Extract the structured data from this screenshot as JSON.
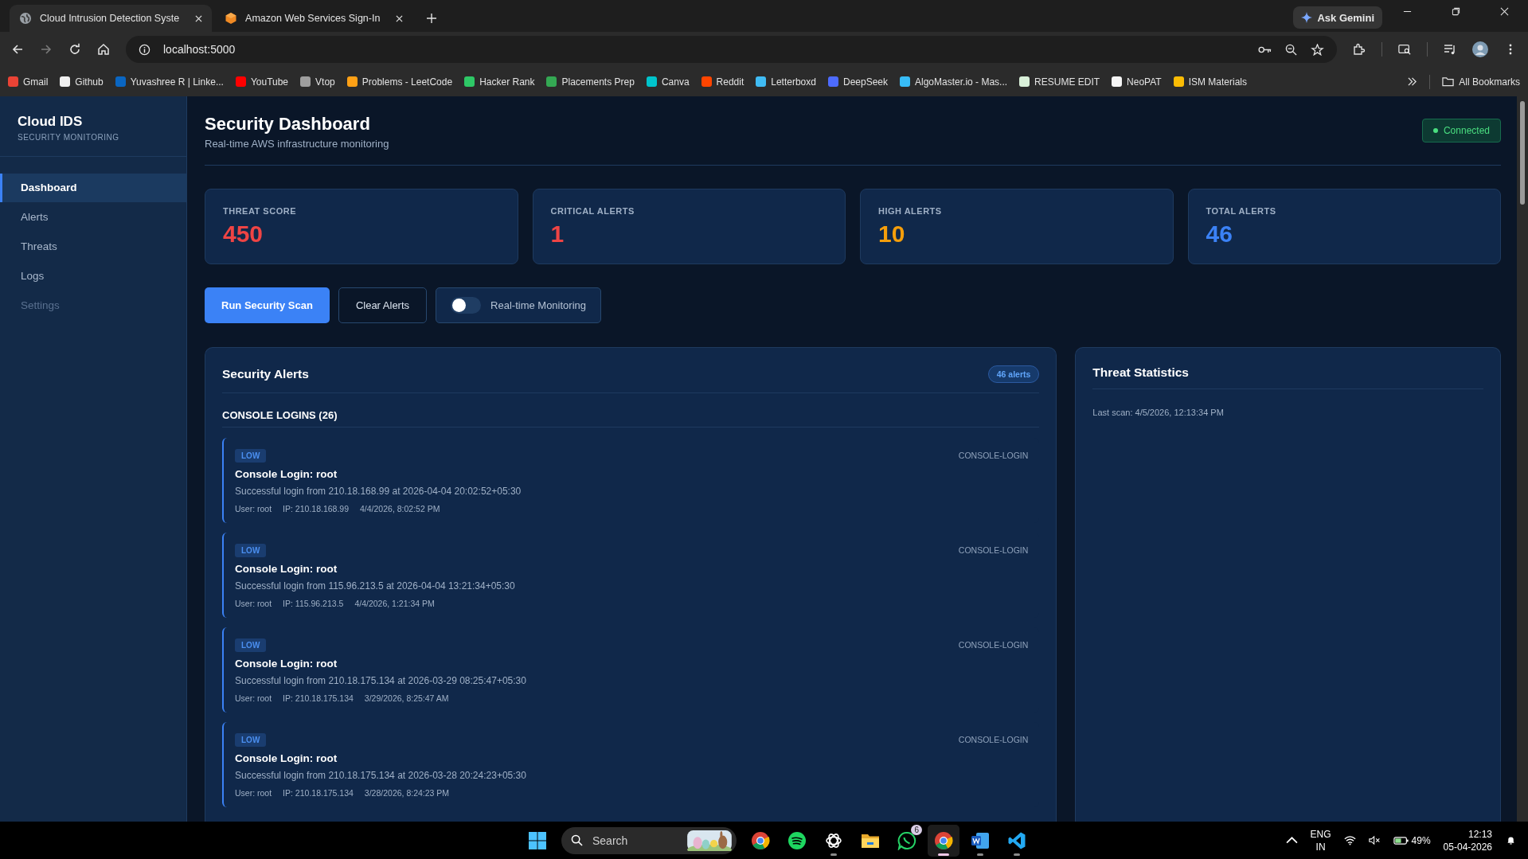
{
  "browser": {
    "tabs": [
      {
        "title": "Cloud Intrusion Detection Syste",
        "selected": true,
        "kind": "globe"
      },
      {
        "title": "Amazon Web Services Sign-In",
        "selected": false,
        "kind": "cube"
      }
    ],
    "gemini_button": "Ask Gemini",
    "address": "localhost:5000",
    "bookmarks": [
      {
        "label": "Gmail",
        "color": "#ea4335"
      },
      {
        "label": "Github",
        "color": "#f0f0f0"
      },
      {
        "label": "Yuvashree R | Linke...",
        "color": "#0a66c2"
      },
      {
        "label": "YouTube",
        "color": "#ff0000"
      },
      {
        "label": "Vtop",
        "color": "#9e9e9e"
      },
      {
        "label": "Problems - LeetCode",
        "color": "#ffa116"
      },
      {
        "label": "Hacker Rank",
        "color": "#2ec866"
      },
      {
        "label": "Placements Prep",
        "color": "#34a853"
      },
      {
        "label": "Canva",
        "color": "#00c4cc"
      },
      {
        "label": "Reddit",
        "color": "#ff4500"
      },
      {
        "label": "Letterboxd",
        "color": "#40bcf4"
      },
      {
        "label": "DeepSeek",
        "color": "#4d6bfe"
      },
      {
        "label": "AlgoMaster.io - Mas...",
        "color": "#38bdf8"
      },
      {
        "label": "RESUME EDIT",
        "color": "#d9f0d9"
      },
      {
        "label": "NeoPAT",
        "color": "#f5f5f5"
      },
      {
        "label": "ISM Materials",
        "color": "#fbbc04"
      }
    ],
    "all_bookmarks": "All Bookmarks"
  },
  "sidebar": {
    "brand": "Cloud IDS",
    "tagline": "SECURITY MONITORING",
    "items": [
      {
        "label": "Dashboard",
        "selected": true,
        "disabled": false
      },
      {
        "label": "Alerts",
        "selected": false,
        "disabled": false
      },
      {
        "label": "Threats",
        "selected": false,
        "disabled": false
      },
      {
        "label": "Logs",
        "selected": false,
        "disabled": false
      },
      {
        "label": "Settings",
        "selected": false,
        "disabled": true
      }
    ]
  },
  "header": {
    "title": "Security Dashboard",
    "subtitle": "Real-time AWS infrastructure monitoring",
    "status": "Connected"
  },
  "stats": [
    {
      "label": "THREAT SCORE",
      "value": "450",
      "color": "#ef4444"
    },
    {
      "label": "CRITICAL ALERTS",
      "value": "1",
      "color": "#ef4444"
    },
    {
      "label": "HIGH ALERTS",
      "value": "10",
      "color": "#f59e0b"
    },
    {
      "label": "TOTAL ALERTS",
      "value": "46",
      "color": "#3b82f6"
    }
  ],
  "actions": {
    "scan_button": "Run Security Scan",
    "clear_button": "Clear Alerts",
    "monitoring": {
      "label": "Real-time Monitoring",
      "on": false
    }
  },
  "alerts_panel": {
    "title": "Security Alerts",
    "count": "46 alerts",
    "groups": [
      {
        "title": "CONSOLE LOGINS (26)",
        "alerts": [
          {
            "severity": "LOW",
            "title": "Console Login: root",
            "description": "Successful login from 210.18.168.99 at 2026-04-04 20:02:52+05:30",
            "user": "User: root",
            "ip": "IP: 210.18.168.99",
            "time": "4/4/2026, 8:02:52 PM",
            "type": "CONSOLE-LOGIN"
          },
          {
            "severity": "LOW",
            "title": "Console Login: root",
            "description": "Successful login from 115.96.213.5 at 2026-04-04 13:21:34+05:30",
            "user": "User: root",
            "ip": "IP: 115.96.213.5",
            "time": "4/4/2026, 1:21:34 PM",
            "type": "CONSOLE-LOGIN"
          },
          {
            "severity": "LOW",
            "title": "Console Login: root",
            "description": "Successful login from 210.18.175.134 at 2026-03-29 08:25:47+05:30",
            "user": "User: root",
            "ip": "IP: 210.18.175.134",
            "time": "3/29/2026, 8:25:47 AM",
            "type": "CONSOLE-LOGIN"
          },
          {
            "severity": "LOW",
            "title": "Console Login: root",
            "description": "Successful login from 210.18.175.134 at 2026-03-28 20:24:23+05:30",
            "user": "User: root",
            "ip": "IP: 210.18.175.134",
            "time": "3/28/2026, 8:24:23 PM",
            "type": "CONSOLE-LOGIN"
          }
        ]
      }
    ]
  },
  "stats_panel": {
    "title": "Threat Statistics",
    "last_scan": "Last scan: 4/5/2026, 12:13:34 PM"
  },
  "taskbar": {
    "search": {
      "placeholder": "Search"
    },
    "apps": [
      {
        "kind": "chrome",
        "running": false,
        "selected": false
      },
      {
        "kind": "spotify",
        "running": false,
        "selected": false
      },
      {
        "kind": "chatgpt",
        "running": true,
        "selected": false
      },
      {
        "kind": "folder",
        "running": false,
        "selected": false
      },
      {
        "kind": "whatsapp",
        "running": false,
        "selected": false,
        "badge": "6"
      },
      {
        "kind": "chrome",
        "running": true,
        "selected": true
      },
      {
        "kind": "word",
        "running": true,
        "selected": false
      },
      {
        "kind": "vscode",
        "running": true,
        "selected": false
      }
    ],
    "language": "ENG",
    "region": "IN",
    "battery": "49%",
    "time": "12:13",
    "date": "05-04-2026"
  }
}
